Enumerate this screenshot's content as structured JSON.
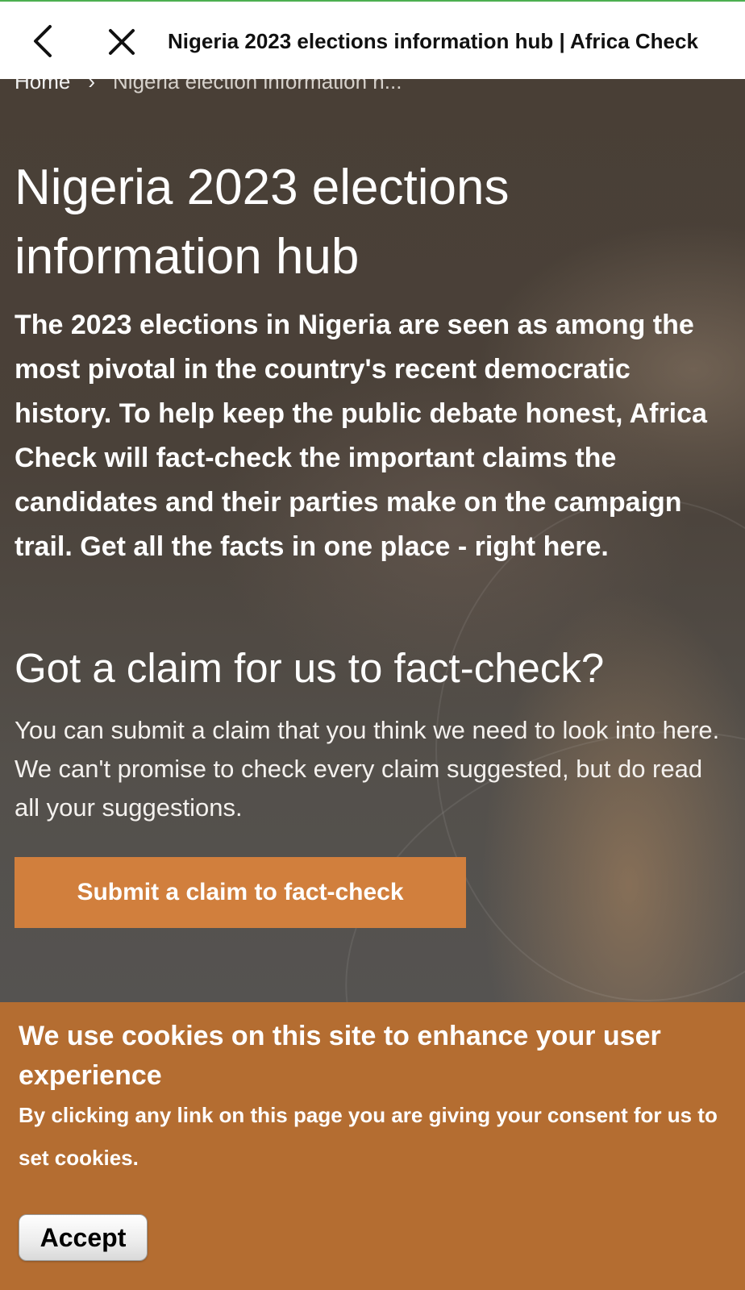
{
  "browser": {
    "title": "Nigeria 2023 elections information hub | Africa Check",
    "back_icon": "chevron-left-icon",
    "close_icon": "close-icon",
    "accent_color": "#4caf50"
  },
  "breadcrumb": {
    "home": "Home",
    "separator_icon": "chevron-right-icon",
    "current": "Nigeria election information h..."
  },
  "hero": {
    "title": "Nigeria 2023 elections information hub",
    "intro": "The 2023 elections in Nigeria are seen as among the most pivotal in the country's recent democratic history. To help keep the public debate honest, Africa Check will fact-check the important claims the candidates and their parties make on the campaign trail. Get all the facts in one place - right here.",
    "claim_heading": "Got a claim for us to fact-check?",
    "claim_text": "You can submit a claim that you think we need to look into here. We can't promise to check every claim suggested, but do read all your suggestions.",
    "submit_label": "Submit a claim to fact-check",
    "button_color": "#d17f3d"
  },
  "cookie_banner": {
    "heading": "We use cookies on this site to enhance your user experience",
    "text": "By clicking any link on this page you are giving your consent for us to set cookies.",
    "accept_label": "Accept",
    "background_color": "#b46d31"
  }
}
